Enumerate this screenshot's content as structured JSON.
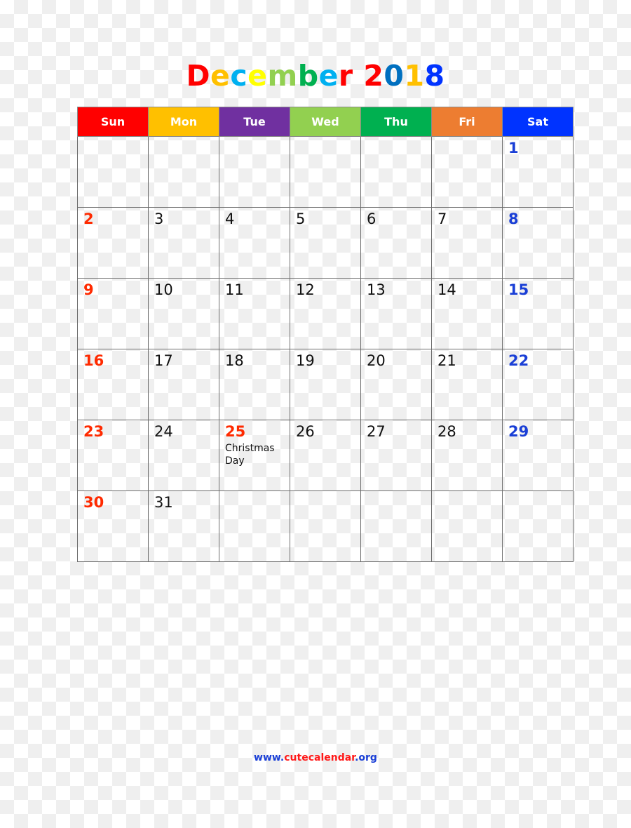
{
  "title": {
    "letters": [
      {
        "ch": "D",
        "color": "#ff0000"
      },
      {
        "ch": "e",
        "color": "#ffc000"
      },
      {
        "ch": "c",
        "color": "#00b0f0"
      },
      {
        "ch": "e",
        "color": "#ffff00"
      },
      {
        "ch": "m",
        "color": "#92d050"
      },
      {
        "ch": "b",
        "color": "#00b050"
      },
      {
        "ch": "e",
        "color": "#00b0f0"
      },
      {
        "ch": "r",
        "color": "#ff0000"
      },
      {
        "ch": " ",
        "color": "#000000"
      },
      {
        "ch": "2",
        "color": "#ff0000"
      },
      {
        "ch": "0",
        "color": "#0070c0"
      },
      {
        "ch": "1",
        "color": "#ffc000"
      },
      {
        "ch": "8",
        "color": "#0033ff"
      }
    ],
    "text": "December 2018"
  },
  "weekdays": [
    {
      "label": "Sun",
      "color": "#ff0000"
    },
    {
      "label": "Mon",
      "color": "#ffc000"
    },
    {
      "label": "Tue",
      "color": "#7030a0"
    },
    {
      "label": "Wed",
      "color": "#92d050"
    },
    {
      "label": "Thu",
      "color": "#00b050"
    },
    {
      "label": "Fri",
      "color": "#ed7d31"
    },
    {
      "label": "Sat",
      "color": "#0033ff"
    }
  ],
  "weeks": [
    [
      null,
      null,
      null,
      null,
      null,
      null,
      {
        "day": "1"
      }
    ],
    [
      {
        "day": "2"
      },
      {
        "day": "3"
      },
      {
        "day": "4"
      },
      {
        "day": "5"
      },
      {
        "day": "6"
      },
      {
        "day": "7"
      },
      {
        "day": "8"
      }
    ],
    [
      {
        "day": "9"
      },
      {
        "day": "10"
      },
      {
        "day": "11"
      },
      {
        "day": "12"
      },
      {
        "day": "13"
      },
      {
        "day": "14"
      },
      {
        "day": "15"
      }
    ],
    [
      {
        "day": "16"
      },
      {
        "day": "17"
      },
      {
        "day": "18"
      },
      {
        "day": "19"
      },
      {
        "day": "20"
      },
      {
        "day": "21"
      },
      {
        "day": "22"
      }
    ],
    [
      {
        "day": "23"
      },
      {
        "day": "24"
      },
      {
        "day": "25",
        "holiday": "Christmas Day"
      },
      {
        "day": "26"
      },
      {
        "day": "27"
      },
      {
        "day": "28"
      },
      {
        "day": "29"
      }
    ],
    [
      {
        "day": "30"
      },
      {
        "day": "31"
      },
      null,
      null,
      null,
      null,
      null
    ]
  ],
  "colors": {
    "sunday": "#ff2a00",
    "saturday": "#1a3fd6",
    "holiday": "#ff2a00",
    "weekday": "#111111"
  },
  "footer": {
    "prefix": "www.",
    "prefix_color": "#1a3fd6",
    "name": "cutecalendar",
    "name_color": "#ff1a1a",
    "suffix": ".org",
    "suffix_color": "#1a3fd6"
  }
}
